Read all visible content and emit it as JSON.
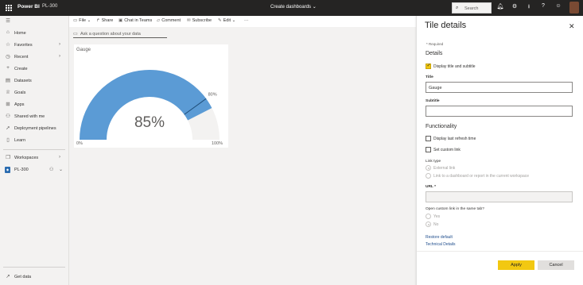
{
  "topbar": {
    "brand": "Power BI",
    "workspace": "PL-300",
    "center_title": "Create dashboards",
    "search_placeholder": "Search",
    "icons": [
      "bell-icon",
      "gear-icon",
      "download-icon",
      "help-icon",
      "smiley-icon"
    ]
  },
  "nav": {
    "items": [
      {
        "label": "Home",
        "icon": "home-icon"
      },
      {
        "label": "Favorites",
        "icon": "star-icon"
      },
      {
        "label": "Recent",
        "icon": "clock-icon"
      },
      {
        "label": "Create",
        "icon": "plus-icon"
      },
      {
        "label": "Datasets",
        "icon": "database-icon"
      },
      {
        "label": "Goals",
        "icon": "trophy-icon"
      },
      {
        "label": "Apps",
        "icon": "apps-icon"
      },
      {
        "label": "Shared with me",
        "icon": "share-icon"
      },
      {
        "label": "Deployment pipelines",
        "icon": "rocket-icon"
      },
      {
        "label": "Learn",
        "icon": "book-icon"
      },
      {
        "label": "Workspaces",
        "icon": "workspaces-icon"
      },
      {
        "label": "PL-300",
        "icon": "workspace-badge-icon"
      }
    ],
    "get_data": "Get data"
  },
  "toolbar": {
    "file": "File",
    "share": "Share",
    "chat": "Chat in Teams",
    "comment": "Comment",
    "subscribe": "Subscribe",
    "edit": "Edit",
    "more": "···"
  },
  "qa": {
    "placeholder": "Ask a question about your data"
  },
  "tile": {
    "title": "Gauge",
    "min_label": "0%",
    "max_label": "100%",
    "target_label": "80%",
    "value_label": "85%",
    "value": 0.85,
    "target": 0.8,
    "colors": {
      "fill": "#5b9bd5",
      "track": "#f3f2f1",
      "target": "#1f4e79"
    }
  },
  "panel": {
    "title": "Tile details",
    "close": "✕",
    "required": "* Required",
    "details_heading": "Details",
    "display_title_label": "Display title and subtitle",
    "title_label": "Title",
    "title_value": "Gauge",
    "subtitle_label": "Subtitle",
    "subtitle_value": "",
    "functionality_heading": "Functionality",
    "last_refresh_label": "Display last refresh time",
    "custom_link_label": "Set custom link",
    "link_type_label": "Link type",
    "external_link": "External link",
    "dashboard_link": "Link to a dashboard or report in the current workspace",
    "url_label": "URL *",
    "open_same_tab_label": "Open custom link in the same tab?",
    "yes": "Yes",
    "no": "No",
    "restore_default": "Restore default",
    "technical_details": "Technical Details",
    "apply": "Apply",
    "cancel": "Cancel"
  }
}
